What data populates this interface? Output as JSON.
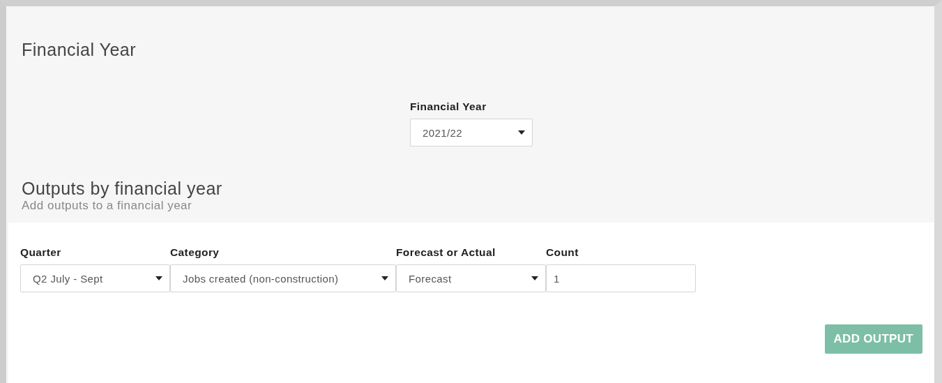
{
  "section_title": "Financial Year",
  "year_field": {
    "label": "Financial Year",
    "value": "2021/22"
  },
  "outputs": {
    "title": "Outputs by financial year",
    "subtitle": "Add outputs to a financial year",
    "fields": [
      {
        "kind": "select",
        "label": "Quarter",
        "value": "Q2 July - Sept"
      },
      {
        "kind": "select",
        "label": "Category",
        "value": "Jobs created (non-construction)"
      },
      {
        "kind": "select",
        "label": "Forecast or Actual",
        "value": "Forecast"
      },
      {
        "kind": "input",
        "label": "Count",
        "value": "1"
      }
    ],
    "button": "ADD OUTPUT"
  }
}
